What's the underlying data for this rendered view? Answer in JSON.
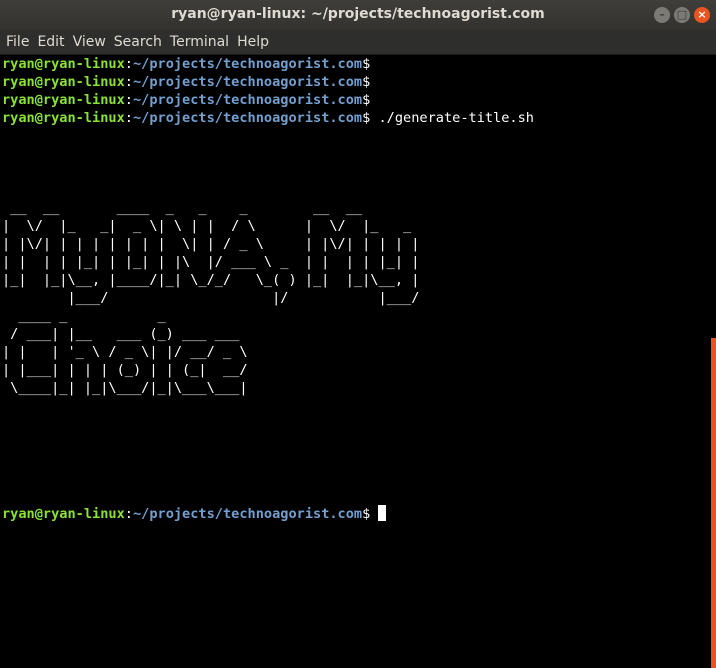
{
  "window": {
    "title": "ryan@ryan-linux: ~/projects/technoagorist.com"
  },
  "menu": [
    "File",
    "Edit",
    "View",
    "Search",
    "Terminal",
    "Help"
  ],
  "prompt": {
    "user": "ryan@ryan-linux",
    "path": "~/projects/technoagorist.com",
    "symbol": "$"
  },
  "commands": [
    "",
    "",
    "",
    " ./generate-title.sh"
  ],
  "ascii_art": " __  __       ____  _   _    _        __  __\n|  \\/  |_   _|  _ \\| \\ | |  / \\      |  \\/  |_   _\n| |\\/| | | | | | | |  \\| | / _ \\     | |\\/| | | | |\n| |  | | |_| | |_| | |\\  |/ ___ \\ _  | |  | | |_| |\n|_|  |_|\\__, |____/|_| \\_/_/   \\_( ) |_|  |_|\\__, |\n        |___/                    |/           |___/\n  ____ _           _\n / ___| |__   ___ (_) ___ ___\n| |   | '_ \\ / _ \\| |/ __/ _ \\\n| |___| | | | (_) | | (_|  __/\n \\____|_| |_|\\___/|_|\\___\\___|"
}
